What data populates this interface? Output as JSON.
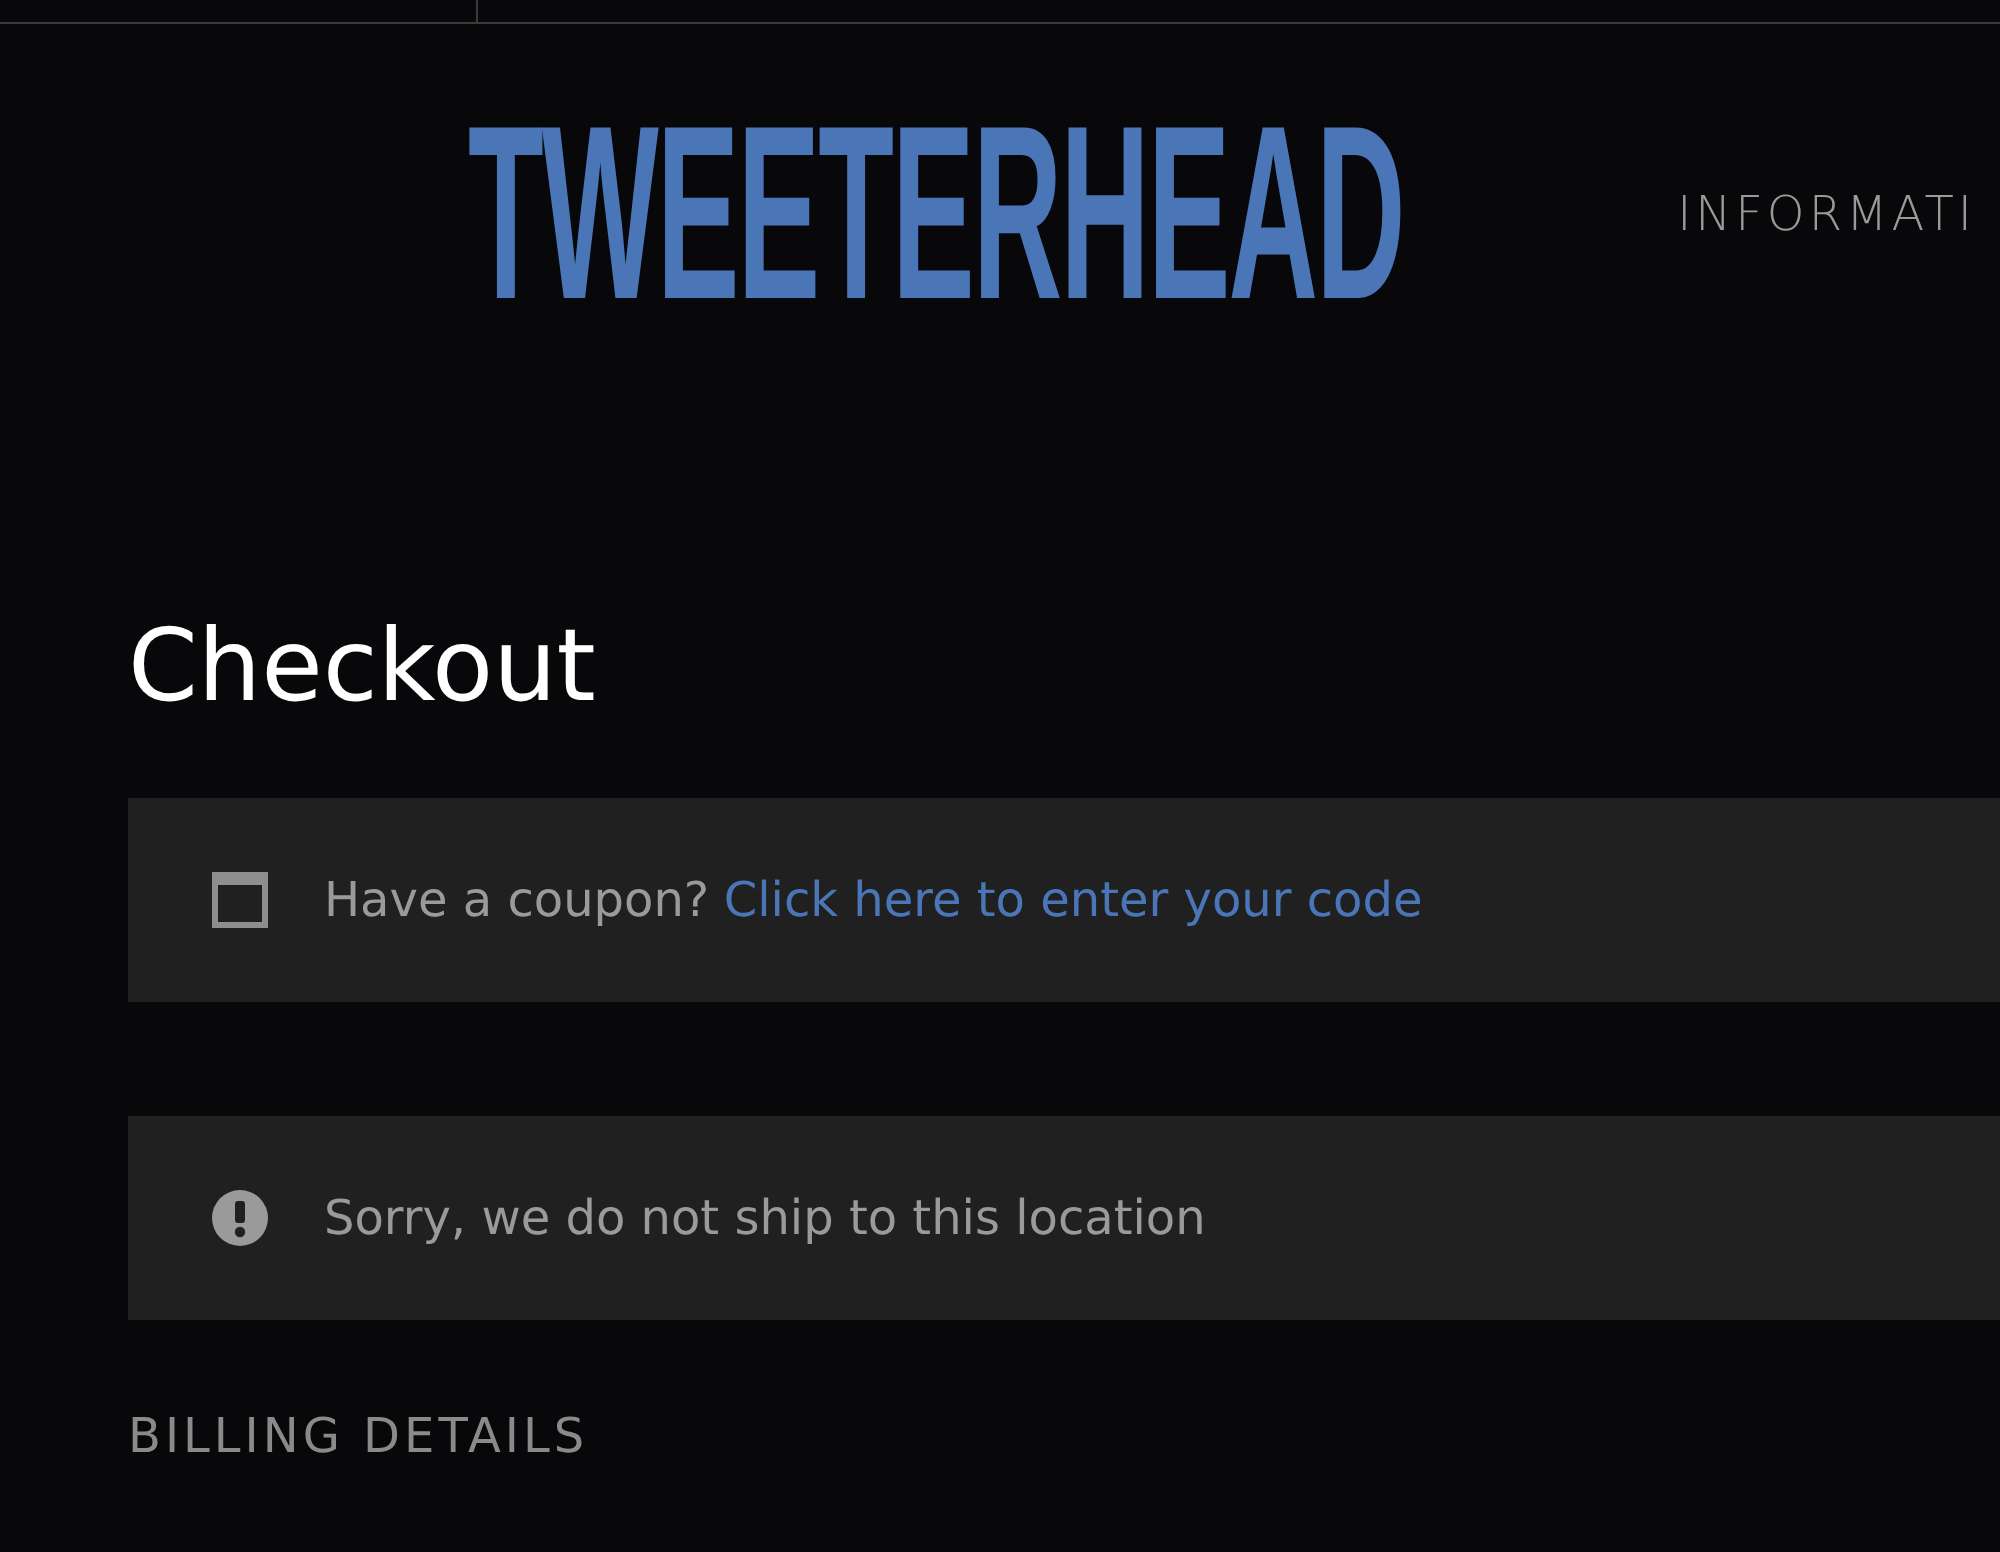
{
  "header": {
    "logo": "TWEETERHEAD",
    "nav": [
      "INFORMATI"
    ]
  },
  "page": {
    "title": "Checkout"
  },
  "notices": [
    {
      "kind": "coupon",
      "text": "Have a coupon?",
      "link": "Click here to enter your code"
    },
    {
      "kind": "error",
      "text": "Sorry, we do not ship to this location"
    }
  ],
  "billing": {
    "heading": "BILLING DETAILS"
  }
}
